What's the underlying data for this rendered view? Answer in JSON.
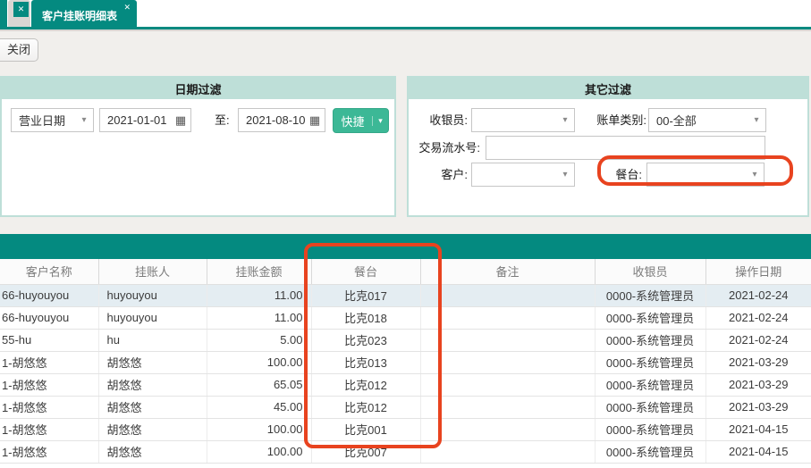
{
  "icons": {
    "caret": "▾",
    "calendar": "▦",
    "close": "✕"
  },
  "colors": {
    "teal": "#048a80",
    "green": "#3cb896",
    "panel_teal": "#bedfd8",
    "annotation_red": "#e8431f",
    "selected_row": "#e4edf2"
  },
  "tabs": {
    "active_label": "客户挂账明细表"
  },
  "toolbar": {
    "close_label": "关闭"
  },
  "filters": {
    "date_panel": {
      "title": "日期过滤",
      "date_type_value": "营业日期",
      "start_date": "2021-01-01",
      "to_label": "至:",
      "end_date": "2021-08-10",
      "quick_label": "快捷"
    },
    "other_panel": {
      "title": "其它过滤",
      "cashier_label": "收银员:",
      "cashier_value": "",
      "bill_type_label": "账单类别:",
      "bill_type_value": "00-全部",
      "txn_label": "交易流水号:",
      "txn_value": "",
      "customer_label": "客户:",
      "customer_value": "",
      "table_label": "餐台:",
      "table_value": ""
    }
  },
  "table": {
    "columns": [
      "客户名称",
      "挂账人",
      "挂账金额",
      "餐台",
      "备注",
      "收银员",
      "操作日期"
    ],
    "rows": [
      {
        "customer": "66-huyouyou",
        "person": "huyouyou",
        "amount": "11.00",
        "table": "比克017",
        "note": "",
        "cashier": "0000-系统管理员",
        "date": "2021-02-24"
      },
      {
        "customer": "66-huyouyou",
        "person": "huyouyou",
        "amount": "11.00",
        "table": "比克018",
        "note": "",
        "cashier": "0000-系统管理员",
        "date": "2021-02-24"
      },
      {
        "customer": "55-hu",
        "person": "hu",
        "amount": "5.00",
        "table": "比克023",
        "note": "",
        "cashier": "0000-系统管理员",
        "date": "2021-02-24"
      },
      {
        "customer": "1-胡悠悠",
        "person": "胡悠悠",
        "amount": "100.00",
        "table": "比克013",
        "note": "",
        "cashier": "0000-系统管理员",
        "date": "2021-03-29"
      },
      {
        "customer": "1-胡悠悠",
        "person": "胡悠悠",
        "amount": "65.05",
        "table": "比克012",
        "note": "",
        "cashier": "0000-系统管理员",
        "date": "2021-03-29"
      },
      {
        "customer": "1-胡悠悠",
        "person": "胡悠悠",
        "amount": "45.00",
        "table": "比克012",
        "note": "",
        "cashier": "0000-系统管理员",
        "date": "2021-03-29"
      },
      {
        "customer": "1-胡悠悠",
        "person": "胡悠悠",
        "amount": "100.00",
        "table": "比克001",
        "note": "",
        "cashier": "0000-系统管理员",
        "date": "2021-04-15"
      },
      {
        "customer": "1-胡悠悠",
        "person": "胡悠悠",
        "amount": "100.00",
        "table": "比克007",
        "note": "",
        "cashier": "0000-系统管理员",
        "date": "2021-04-15"
      }
    ]
  }
}
